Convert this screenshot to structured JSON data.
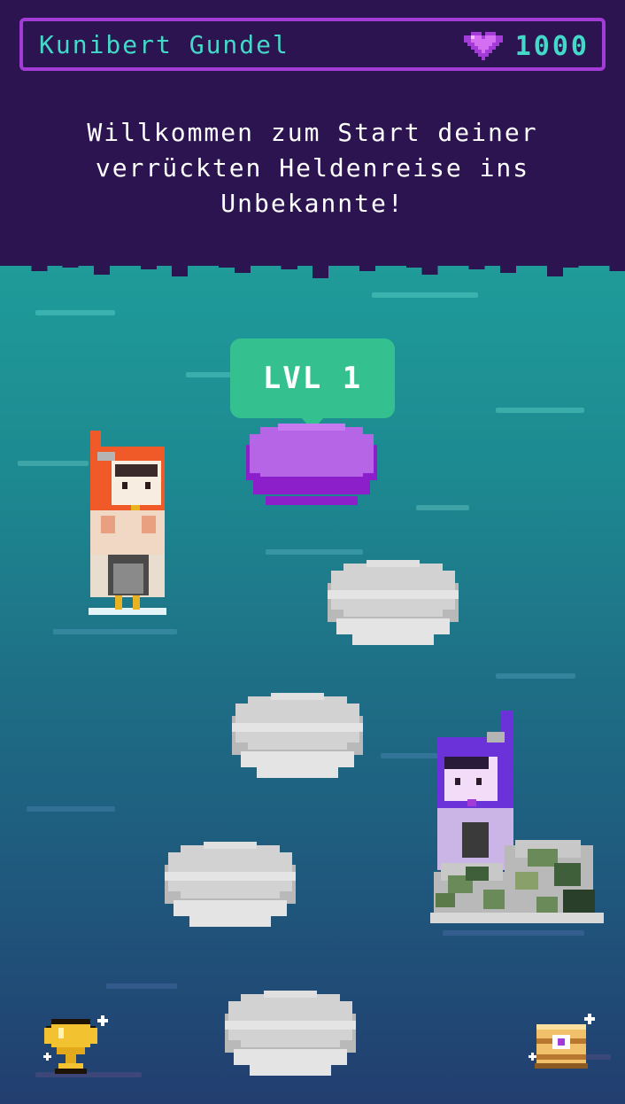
{
  "header": {
    "player_name": "Kunibert Gundel",
    "gem_count": "1000",
    "welcome_text": "Willkommen zum Start deiner verrückten Heldenreise ins Unbekannte!"
  },
  "map": {
    "current_level_label": "LVL 1",
    "stones": [
      "active",
      "locked",
      "locked",
      "locked",
      "locked"
    ]
  },
  "icons": {
    "gem": "heart-gem-icon",
    "trophy": "trophy-icon",
    "chest": "treasure-chest-icon"
  },
  "colors": {
    "header_bg": "#2c1450",
    "accent_purple": "#a33cd6",
    "text_teal": "#44d8c8",
    "level_green": "#35c18f",
    "active_stone": "#b565e6",
    "locked_stone": "#d4d4d4"
  }
}
